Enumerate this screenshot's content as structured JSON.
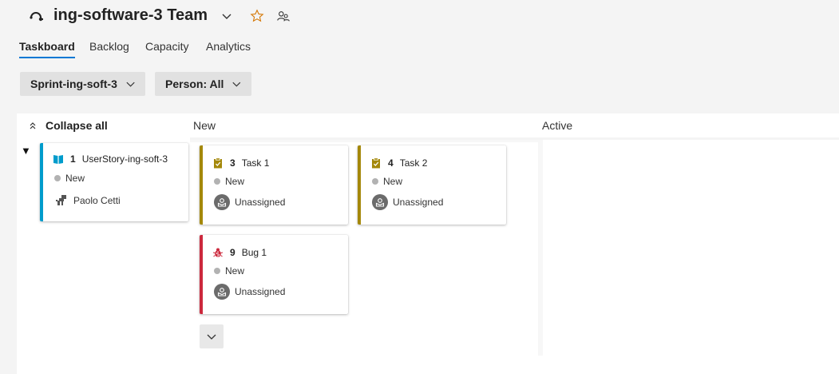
{
  "header": {
    "team_title": "ing-software-3 Team"
  },
  "tabs": [
    {
      "label": "Taskboard",
      "active": true
    },
    {
      "label": "Backlog"
    },
    {
      "label": "Capacity"
    },
    {
      "label": "Analytics"
    }
  ],
  "filters": {
    "sprint": "Sprint-ing-soft-3",
    "person": "Person: All"
  },
  "board": {
    "collapse_all": "Collapse all",
    "columns": [
      "New",
      "Active"
    ],
    "story": {
      "id": "1",
      "title": "UserStory-ing-soft-3",
      "state": "New",
      "assignee": "Paolo Cetti",
      "accent": "#009ccc"
    },
    "cards": [
      {
        "id": "3",
        "title": "Task 1",
        "state": "New",
        "assignee": "Unassigned",
        "accent": "#a4880a",
        "type_icon": "task-icon"
      },
      {
        "id": "4",
        "title": "Task 2",
        "state": "New",
        "assignee": "Unassigned",
        "accent": "#a4880a",
        "type_icon": "task-icon"
      },
      {
        "id": "9",
        "title": "Bug 1",
        "state": "New",
        "assignee": "Unassigned",
        "accent": "#cc293d",
        "type_icon": "bug-icon"
      }
    ]
  },
  "colors": {
    "accent_blue": "#0078d4",
    "state_new_dot": "#b2b2b2"
  }
}
